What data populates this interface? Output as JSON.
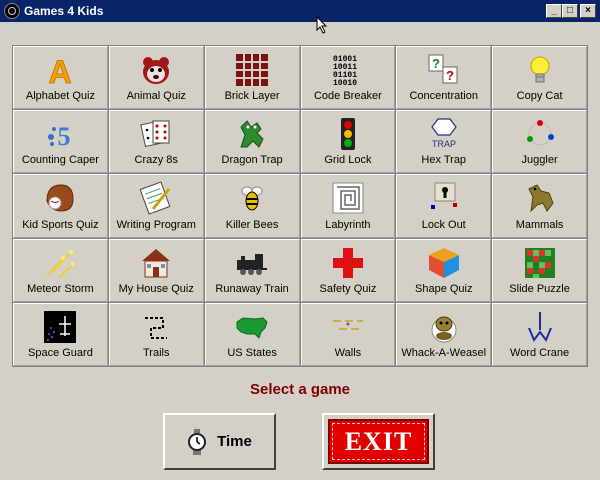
{
  "window": {
    "title": "Games 4 Kids",
    "controls": {
      "minimize": "_",
      "maximize": "□",
      "close": "×"
    }
  },
  "games": [
    {
      "label": "Alphabet Quiz",
      "icon": "letter-a-icon"
    },
    {
      "label": "Animal Quiz",
      "icon": "animal-face-icon"
    },
    {
      "label": "Brick Layer",
      "icon": "brick-grid-icon"
    },
    {
      "label": "Code Breaker",
      "icon": "binary-code-icon"
    },
    {
      "label": "Concentration",
      "icon": "question-cards-icon"
    },
    {
      "label": "Copy Cat",
      "icon": "lightbulb-icon"
    },
    {
      "label": "Counting Caper",
      "icon": "number-five-icon"
    },
    {
      "label": "Crazy 8s",
      "icon": "playing-cards-icon"
    },
    {
      "label": "Dragon Trap",
      "icon": "dragon-icon"
    },
    {
      "label": "Grid Lock",
      "icon": "traffic-light-icon"
    },
    {
      "label": "Hex Trap",
      "icon": "hexagon-trap-icon"
    },
    {
      "label": "Juggler",
      "icon": "juggling-balls-icon"
    },
    {
      "label": "Kid Sports Quiz",
      "icon": "baseball-glove-icon"
    },
    {
      "label": "Writing Program",
      "icon": "notepad-pencil-icon"
    },
    {
      "label": "Killer Bees",
      "icon": "bee-icon"
    },
    {
      "label": "Labyrinth",
      "icon": "maze-icon"
    },
    {
      "label": "Lock Out",
      "icon": "keyhole-icon"
    },
    {
      "label": "Mammals",
      "icon": "mammal-icon"
    },
    {
      "label": "Meteor Storm",
      "icon": "meteor-icon"
    },
    {
      "label": "My House Quiz",
      "icon": "house-icon"
    },
    {
      "label": "Runaway Train",
      "icon": "train-icon"
    },
    {
      "label": "Safety Quiz",
      "icon": "red-cross-icon"
    },
    {
      "label": "Shape Quiz",
      "icon": "cube-icon"
    },
    {
      "label": "Slide Puzzle",
      "icon": "slide-puzzle-icon"
    },
    {
      "label": "Space Guard",
      "icon": "space-guard-icon"
    },
    {
      "label": "Trails",
      "icon": "trail-path-icon"
    },
    {
      "label": "US States",
      "icon": "us-map-icon"
    },
    {
      "label": "Walls",
      "icon": "walls-icon"
    },
    {
      "label": "Whack-A-Weasel",
      "icon": "weasel-icon"
    },
    {
      "label": "Word Crane",
      "icon": "crane-icon"
    }
  ],
  "prompt": "Select a game",
  "buttons": {
    "time_label": "Time",
    "exit_label": "EXIT"
  },
  "tile_icon_text": {
    "alphabet": "A",
    "code_lines": [
      "01001",
      "10011",
      "01101",
      "10010"
    ],
    "concentration_q": "?",
    "counting": "5",
    "hex_trap": "TRAP"
  },
  "colors": {
    "titlebar": "#0a246a",
    "face": "#d4d0c8",
    "prompt": "#800000",
    "exit_red": "#e00000"
  }
}
